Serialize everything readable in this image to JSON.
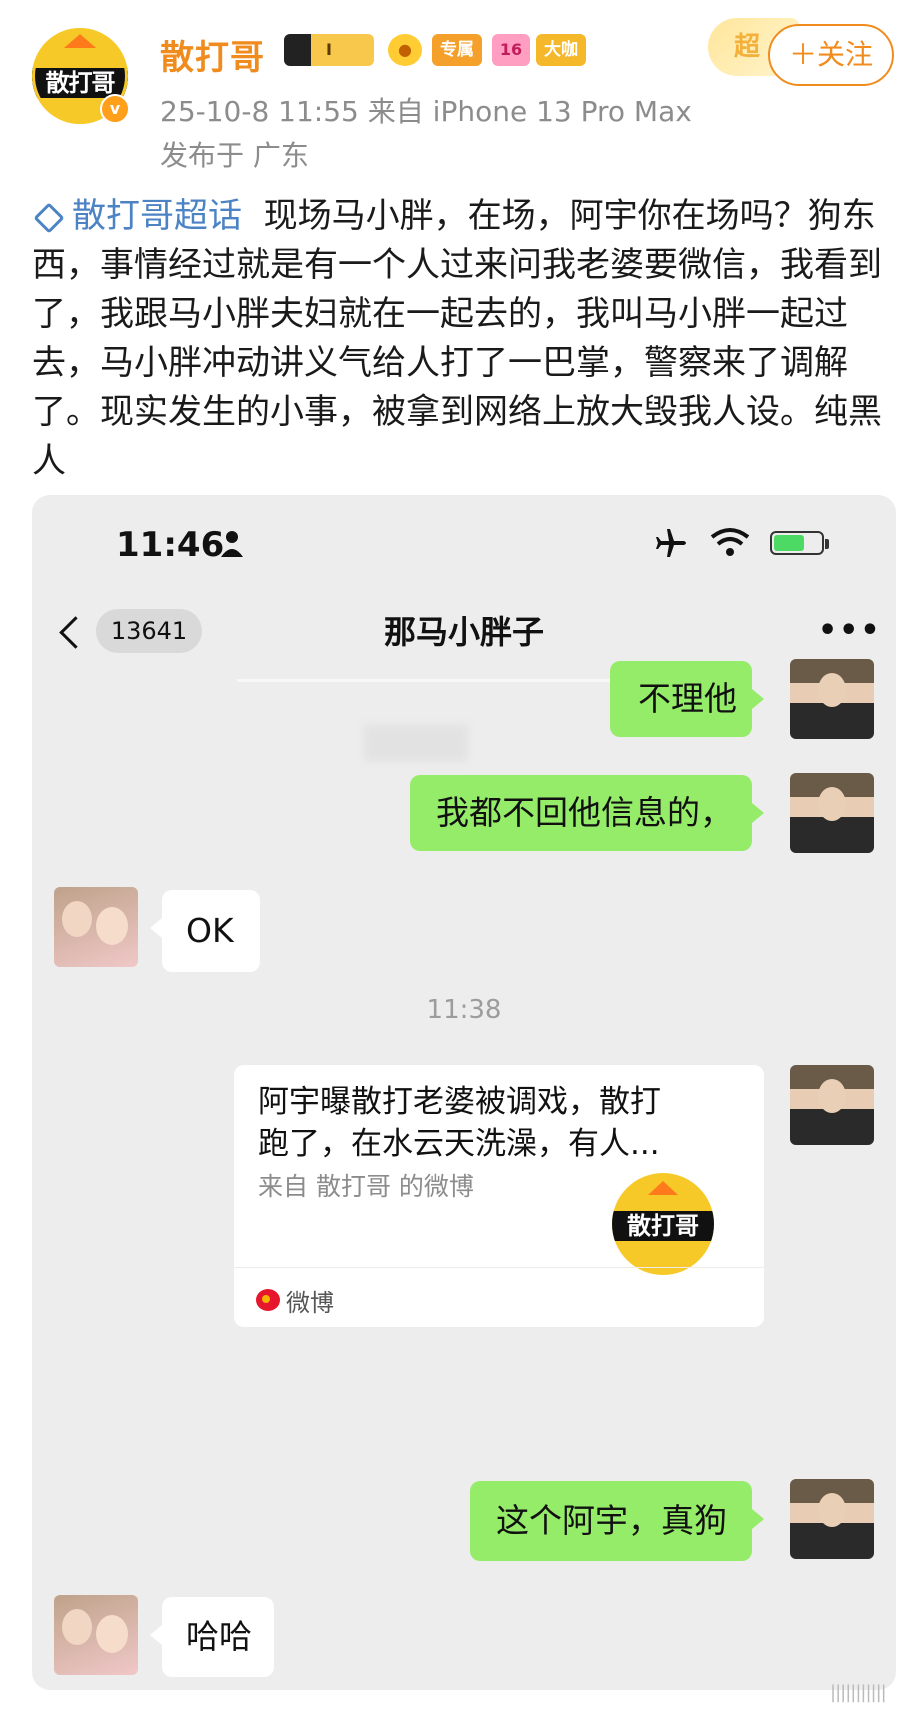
{
  "header": {
    "avatar_text": "散打哥",
    "verified_mark": "v",
    "username": "散打哥",
    "level_badge": "I",
    "exclusive_badge": "专属",
    "diamond_badge": "16",
    "bigshot_badge": "大咖",
    "super_deco": "超",
    "follow_label": "＋关注",
    "post_time": "25-10-8 11:55   来自 iPhone 13 Pro Max",
    "post_location": "发布于 广东"
  },
  "post": {
    "supertopic": "散打哥超话",
    "text": "现场马小胖，在场，阿宇你在场吗？狗东西，事情经过就是有一个人过来问我老婆要微信，我看到了，我跟马小胖夫妇就在一起去的，我叫马小胖一起过去，马小胖冲动讲义气给人打了一巴掌，警察来了调解了。现实发生的小事，被拿到网络上放大毁我人设。纯黑人"
  },
  "chat": {
    "phone_time": "11:46",
    "unread_count": "13641",
    "title": "那马小胖子",
    "more": "•••",
    "messages": {
      "m1": "不理他",
      "m2": "我都不回他信息的，",
      "m3": "OK",
      "time_divider": "11:38",
      "m5": "这个阿宇，真狗",
      "m6": "哈哈"
    },
    "card": {
      "title": "阿宇曝散打老婆被调戏，散打跑了，在水云天洗澡，有人...",
      "source": "来自 散打哥 的微博",
      "logo_text": "散打哥",
      "app": "微博"
    }
  },
  "icons": [
    "crown-icon",
    "verified-icon",
    "fish-icon",
    "diamond-icon",
    "person-icon",
    "airplane-icon",
    "wifi-icon",
    "battery-icon",
    "back-icon",
    "more-icon",
    "weibo-icon"
  ],
  "colors": {
    "username": "#f08c1e",
    "link": "#4c83c5",
    "bubble_green": "#95ec69",
    "chat_bg": "#ededed"
  }
}
